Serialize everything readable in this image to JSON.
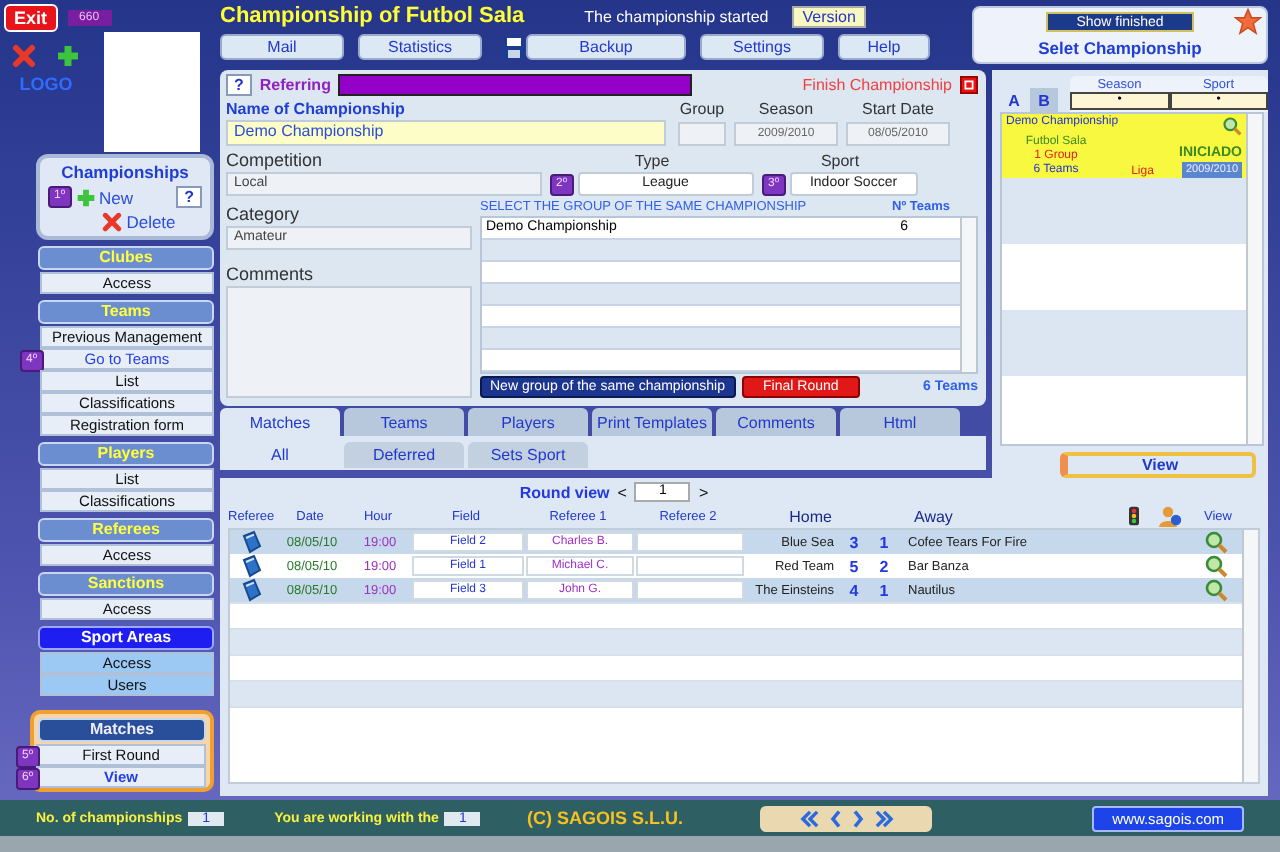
{
  "header": {
    "exit": "Exit",
    "badge": "660",
    "title": "Championship of Futbol Sala",
    "status": "The championship started",
    "version": "Version",
    "nav": [
      "Mail",
      "Statistics",
      "Backup",
      "Settings",
      "Help"
    ],
    "show_finished": "Show finished",
    "select_title": "Selet Championship"
  },
  "logo": {
    "text": "LOGO"
  },
  "championships": {
    "title": "Championships",
    "badge": "1º",
    "new": "New",
    "help": "?",
    "delete": "Delete"
  },
  "sidebar": [
    {
      "title": "Clubes",
      "kind": "normal",
      "items": [
        {
          "label": "Access",
          "link": false
        }
      ]
    },
    {
      "title": "Teams",
      "kind": "normal",
      "items": [
        {
          "label": "Previous Management",
          "link": false
        },
        {
          "label": "Go to Teams",
          "badge": "4º",
          "link": true
        },
        {
          "label": "List",
          "link": false
        },
        {
          "label": "Classifications",
          "link": false
        },
        {
          "label": "Registration form",
          "link": false
        }
      ]
    },
    {
      "title": "Players",
      "kind": "normal",
      "items": [
        {
          "label": "List",
          "link": false
        },
        {
          "label": "Classifications",
          "link": false
        }
      ]
    },
    {
      "title": "Referees",
      "kind": "normal",
      "items": [
        {
          "label": "Access",
          "link": false
        }
      ]
    },
    {
      "title": "Sanctions",
      "kind": "normal",
      "items": [
        {
          "label": "Access",
          "link": false
        }
      ]
    },
    {
      "title": "Sport Areas",
      "kind": "active",
      "items": [
        {
          "label": "Access",
          "link": false
        },
        {
          "label": "Users",
          "link": false
        }
      ]
    },
    {
      "title": "Matches",
      "kind": "featured",
      "items": [
        {
          "label": "First Round",
          "badge": "5º",
          "link": false
        },
        {
          "label": "View",
          "badge": "6º",
          "link": true
        }
      ]
    }
  ],
  "form": {
    "help": "?",
    "referring": "Referring",
    "finish": "Finish Championship",
    "name_label": "Name of Championship",
    "name": "Demo Championship",
    "group_label": "Group",
    "season_label": "Season",
    "season": "2009/2010",
    "start_label": "Start Date",
    "start": "08/05/2010",
    "competition_label": "Competition",
    "competition": "Local",
    "type_label": "Type",
    "type_badge": "2º",
    "type": "League",
    "sport_label": "Sport",
    "sport_badge": "3º",
    "sport": "Indoor Soccer",
    "category_label": "Category",
    "category": "Amateur",
    "comments_label": "Comments",
    "groups_title": "SELECT THE GROUP OF THE SAME CHAMPIONSHIP",
    "groups_count_label": "Nº Teams",
    "groups": [
      {
        "name": "Demo Championship",
        "teams": "6"
      }
    ],
    "new_group": "New group of the same championship",
    "final_round": "Final Round",
    "teams_total": "6 Teams"
  },
  "list_panel": {
    "tabs": [
      {
        "label": "A",
        "selected": true
      },
      {
        "label": "B",
        "selected": false
      }
    ],
    "season_label": "Season",
    "season": "•",
    "sport_label": "Sport",
    "sport": "•",
    "cards": [
      {
        "name": "Demo Championship",
        "sport": "Futbol Sala",
        "groups": "1 Group",
        "teams": "6 Teams",
        "type": "Liga",
        "status": "INICIADO",
        "season": "2009/2010"
      }
    ],
    "view": "View"
  },
  "tabs": [
    {
      "label": "Matches",
      "selected": true
    },
    {
      "label": "Teams",
      "selected": false
    },
    {
      "label": "Players",
      "selected": false
    },
    {
      "label": "Print Templates",
      "selected": false
    },
    {
      "label": "Comments",
      "selected": false
    },
    {
      "label": "Html",
      "selected": false
    }
  ],
  "subtabs": [
    {
      "label": "All",
      "selected": true
    },
    {
      "label": "Deferred",
      "selected": false
    },
    {
      "label": "Sets Sport",
      "selected": false
    }
  ],
  "round": {
    "label": "Round view",
    "prev": "<",
    "value": "1",
    "next": ">"
  },
  "matches": {
    "columns": [
      "Referee",
      "Date",
      "Hour",
      "Field",
      "Referee 1",
      "Referee 2",
      "Home",
      "Away",
      "View"
    ],
    "rows": [
      {
        "date": "08/05/10",
        "hour": "19:00",
        "field": "Field 2",
        "referee_1": "Charles B.",
        "home": "Blue Sea",
        "home_score": "3",
        "away_score": "1",
        "away": "Cofee Tears For Fire"
      },
      {
        "date": "08/05/10",
        "hour": "19:00",
        "field": "Field 1",
        "referee_1": "Michael C.",
        "home": "Red Team",
        "home_score": "5",
        "away_score": "2",
        "away": "Bar Banza"
      },
      {
        "date": "08/05/10",
        "hour": "19:00",
        "field": "Field 3",
        "referee_1": "John G.",
        "home": "The Einsteins",
        "home_score": "4",
        "away_score": "1",
        "away": "Nautilus"
      }
    ]
  },
  "footer": {
    "count_label": "No. of championships",
    "count": "1",
    "working_label": "You are working with the",
    "working": "1",
    "copyright": "(C) SAGOIS S.L.U.",
    "website": "www.sagois.com"
  }
}
